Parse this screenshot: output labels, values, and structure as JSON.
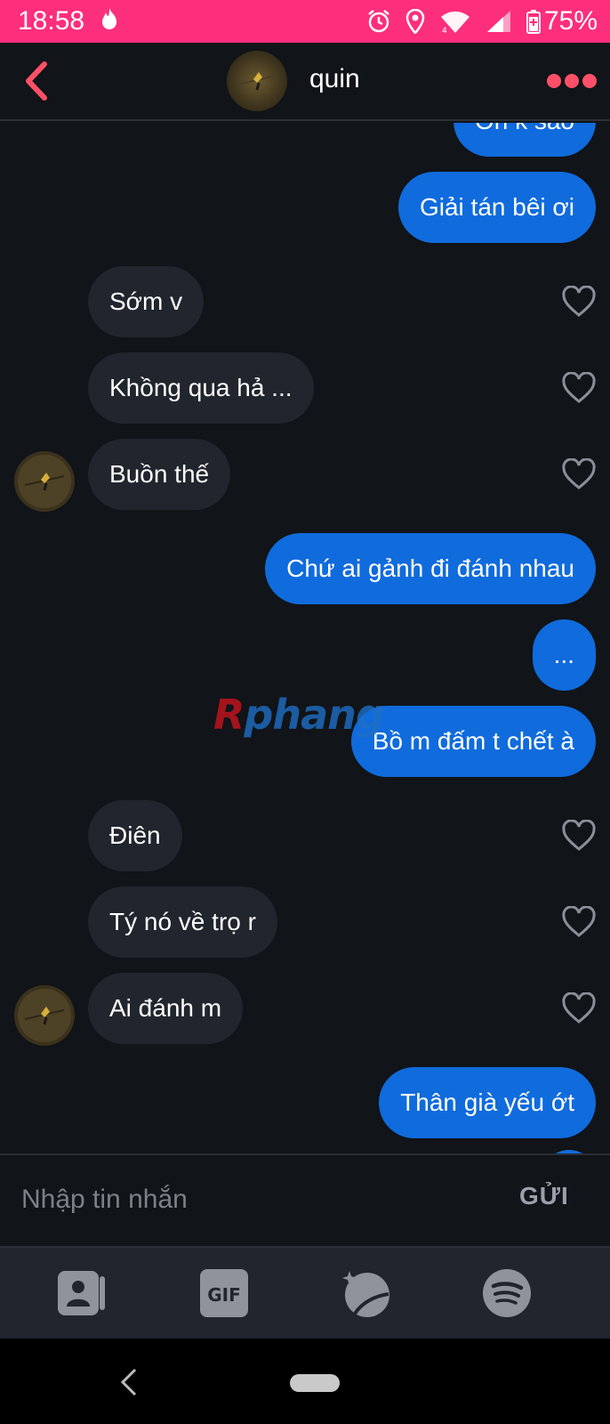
{
  "status_bar": {
    "time": "18:58",
    "battery": "75%",
    "background": "#fd2e7c",
    "icons": [
      "tinder-flame-icon",
      "alarm-icon",
      "location-icon",
      "wifi-icon",
      "signal-icon",
      "battery-icon"
    ]
  },
  "header": {
    "contact_name": "quin",
    "accent_color": "#fd5068"
  },
  "messages": [
    {
      "id": "m0",
      "direction": "sent",
      "text": "Oh k sao"
    },
    {
      "id": "m1",
      "direction": "sent",
      "text": "Giải tán bêi ơi"
    },
    {
      "id": "m2",
      "direction": "received",
      "text": "Sớm v",
      "avatar": false
    },
    {
      "id": "m3",
      "direction": "received",
      "text": "Khồng qua hả ...",
      "avatar": false
    },
    {
      "id": "m4",
      "direction": "received",
      "text": "Buồn thế",
      "avatar": true
    },
    {
      "id": "m5",
      "direction": "sent",
      "text": "Chứ ai gảnh đi đánh nhau"
    },
    {
      "id": "m6",
      "direction": "sent",
      "text": "..."
    },
    {
      "id": "m7",
      "direction": "sent",
      "text": "Bồ m đấm t chết à"
    },
    {
      "id": "m8",
      "direction": "received",
      "text": "Điên",
      "avatar": false
    },
    {
      "id": "m9",
      "direction": "received",
      "text": "Tý nó về trọ r",
      "avatar": false
    },
    {
      "id": "m10",
      "direction": "received",
      "text": "Ai đánh m",
      "avatar": true
    },
    {
      "id": "m11",
      "direction": "sent",
      "text": "Thân già yếu ớt"
    }
  ],
  "watermark": {
    "part1": "R",
    "part2": "phang"
  },
  "composer": {
    "placeholder": "Nhập tin nhắn",
    "value": "",
    "send_label": "GỬI"
  },
  "toolbar": {
    "gif_label": "GIF",
    "icons": [
      "contact-card-icon",
      "gif-icon",
      "sticker-icon",
      "spotify-icon"
    ]
  },
  "colors": {
    "sent_bubble": "#106bdd",
    "received_bubble": "#21252d",
    "background": "#111418"
  }
}
